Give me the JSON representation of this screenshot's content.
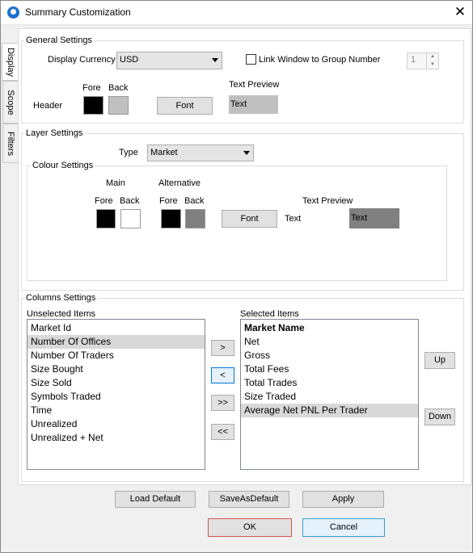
{
  "window": {
    "title": "Summary Customization",
    "close_glyph": "✕"
  },
  "tabs": [
    {
      "label": "Display",
      "active": true
    },
    {
      "label": "Scope",
      "active": false
    },
    {
      "label": "Filters",
      "active": false
    }
  ],
  "general": {
    "title": "General Settings",
    "currency_label": "Display Currency",
    "currency_value": "USD",
    "link_label": "Link Window to Group Number",
    "link_checked": false,
    "group_number": "1",
    "fore_label": "Fore",
    "back_label": "Back",
    "header_label": "Header",
    "header_fore": "#000000",
    "header_back": "#c0c0c0",
    "font_button": "Font",
    "preview_label": "Text Preview",
    "preview_text": "Text"
  },
  "layer": {
    "title": "Layer Settings",
    "type_label": "Type",
    "type_value": "Market",
    "colour_title": "Colour Settings",
    "main_label": "Main",
    "alt_label": "Alternative",
    "fore_label": "Fore",
    "back_label": "Back",
    "main_fore": "#000000",
    "main_back": "#ffffff",
    "alt_fore": "#000000",
    "alt_back": "#808080",
    "font_button": "Font",
    "preview_label": "Text Preview",
    "preview_plain": "Text",
    "preview_text": "Text"
  },
  "columns": {
    "title": "Columns Settings",
    "unselected_label": "Unselected Items",
    "selected_label": "Selected Items",
    "unselected": [
      "Market Id",
      "Number Of Offices",
      "Number Of Traders",
      "Size Bought",
      "Size Sold",
      "Symbols Traded",
      "Time",
      "Unrealized",
      "Unrealized + Net"
    ],
    "unselected_highlight": 1,
    "selected": [
      "Market Name",
      "Net",
      "Gross",
      "Total Fees",
      "Total Trades",
      "Size Traded",
      "Average Net PNL Per Trader"
    ],
    "selected_bold": 0,
    "selected_highlight": 6,
    "btn_add": ">",
    "btn_remove": "<",
    "btn_add_all": ">>",
    "btn_remove_all": "<<",
    "btn_up": "Up",
    "btn_down": "Down"
  },
  "footer": {
    "load_default": "Load Default",
    "save_default": "SaveAsDefault",
    "apply": "Apply",
    "ok": "OK",
    "cancel": "Cancel"
  }
}
